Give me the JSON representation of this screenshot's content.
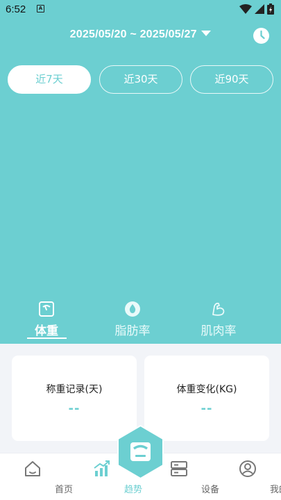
{
  "status_bar": {
    "time": "6:52",
    "notification_letter": "A"
  },
  "header": {
    "date_range": "2025/05/20 ~ 2025/05/27"
  },
  "range_tabs": [
    {
      "label": "近7天",
      "active": true
    },
    {
      "label": "近30天",
      "active": false
    },
    {
      "label": "近90天",
      "active": false
    }
  ],
  "metric_tabs": [
    {
      "label": "体重",
      "icon": "scale-icon",
      "active": true
    },
    {
      "label": "脂肪率",
      "icon": "drop-icon",
      "active": false
    },
    {
      "label": "肌肉率",
      "icon": "muscle-icon",
      "active": false
    }
  ],
  "cards": {
    "record": {
      "title": "称重记录(天)",
      "value": "--"
    },
    "change": {
      "title": "体重变化(KG)",
      "value": "--"
    }
  },
  "bottom_nav": [
    {
      "label": "首页",
      "icon": "home-icon",
      "active": false
    },
    {
      "label": "趋势",
      "icon": "trend-icon",
      "active": true
    },
    {
      "label": "设备",
      "icon": "device-icon",
      "active": false
    },
    {
      "label": "我的",
      "icon": "profile-icon",
      "active": false
    }
  ],
  "colors": {
    "primary": "#6ccfd1",
    "panel_bg": "#f2f4f8",
    "text_dark": "#222222"
  }
}
